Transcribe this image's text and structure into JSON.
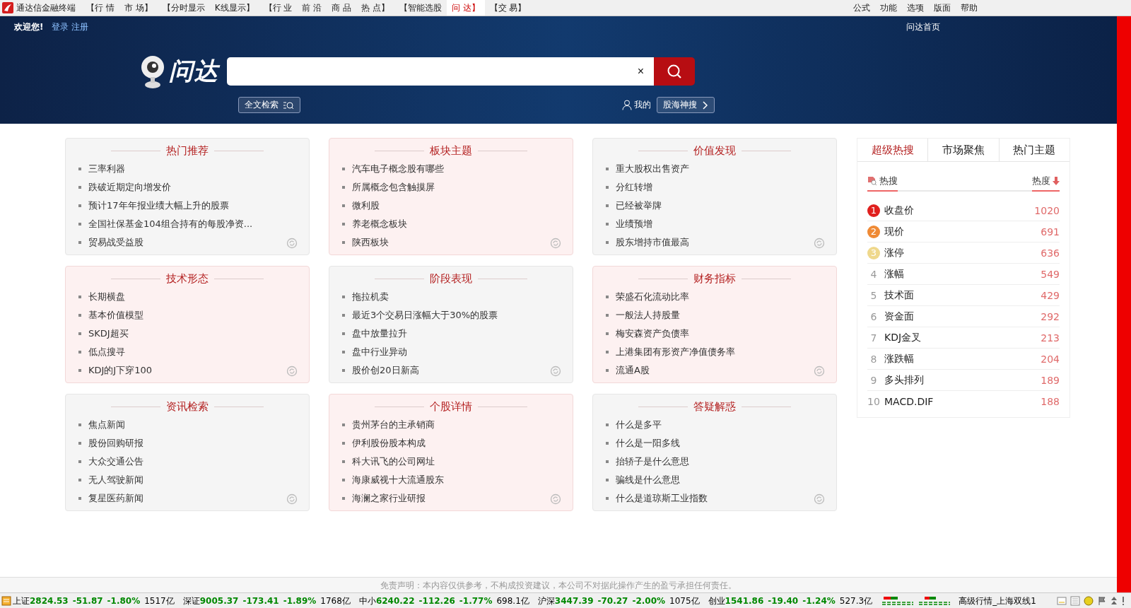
{
  "menu_bar": {
    "app_title": "通达信金融终端",
    "items": [
      {
        "label": "【行 情",
        "selected": false
      },
      {
        "label": "市 场】",
        "selected": false
      },
      {
        "label": "【分时显示",
        "selected": false
      },
      {
        "label": "K线显示】",
        "selected": false
      },
      {
        "label": "【行 业",
        "selected": false
      },
      {
        "label": "前 沿",
        "selected": false
      },
      {
        "label": "商 品",
        "selected": false
      },
      {
        "label": "热 点】",
        "selected": false
      },
      {
        "label": "【智能选股",
        "selected": false
      },
      {
        "label": "问 达】",
        "selected": true
      },
      {
        "label": "【交 易】",
        "selected": false
      }
    ],
    "right_items": [
      "公式",
      "功能",
      "选项",
      "版面",
      "帮助"
    ]
  },
  "header": {
    "welcome": "欢迎您!",
    "login": "登录",
    "register": "注册",
    "nav_links": [
      "问达首页"
    ],
    "logo_text": "问达",
    "search": {
      "clear": "×"
    },
    "fulltext_button": "全文检索",
    "mine": "我的",
    "deep_search_button": "股海神搜"
  },
  "cards": [
    {
      "title": "热门推荐",
      "kind": "plain",
      "items": [
        "三率利器",
        "跌破近期定向增发价",
        "预计17年年报业绩大幅上升的股票",
        "全国社保基金104组合持有的每股净资...",
        "贸易战受益股"
      ]
    },
    {
      "title": "板块主题",
      "kind": "tinted",
      "items": [
        "汽车电子概念股有哪些",
        "所属概念包含触摸屏",
        "微利股",
        "养老概念板块",
        "陕西板块"
      ]
    },
    {
      "title": "价值发现",
      "kind": "plain",
      "items": [
        "重大股权出售资产",
        "分红转增",
        "已经被举牌",
        "业绩预增",
        "股东增持市值最高"
      ]
    },
    {
      "title": "技术形态",
      "kind": "tinted",
      "items": [
        "长期横盘",
        "基本价值模型",
        "SKDJ超买",
        "低点搜寻",
        "KDJ的J下穿100"
      ]
    },
    {
      "title": "阶段表现",
      "kind": "plain",
      "items": [
        "拖拉机卖",
        "最近3个交易日涨幅大于30%的股票",
        "盘中放量拉升",
        "盘中行业异动",
        "股价创20日新高"
      ]
    },
    {
      "title": "财务指标",
      "kind": "tinted",
      "items": [
        "荣盛石化流动比率",
        "一般法人持股量",
        "梅安森资产负债率",
        "上港集团有形资产净值债务率",
        "流通A股"
      ]
    },
    {
      "title": "资讯检索",
      "kind": "plain",
      "items": [
        "焦点新闻",
        "股份回购研报",
        "大众交通公告",
        "无人驾驶新闻",
        "复星医药新闻"
      ]
    },
    {
      "title": "个股详情",
      "kind": "tinted",
      "items": [
        "贵州茅台的主承销商",
        "伊利股份股本构成",
        "科大讯飞的公司网址",
        "海康威视十大流通股东",
        "海澜之家行业研报"
      ]
    },
    {
      "title": "答疑解惑",
      "kind": "plain",
      "items": [
        "什么是多平",
        "什么是一阳多线",
        "抬轿子是什么意思",
        "骗线是什么意思",
        "什么是道琼斯工业指数"
      ]
    }
  ],
  "hot_panel": {
    "tabs": [
      {
        "label": "超级热搜",
        "selected": true
      },
      {
        "label": "市场聚焦",
        "selected": false
      },
      {
        "label": "热门主题",
        "selected": false
      }
    ],
    "col_name": "热搜",
    "col_heat": "热度",
    "rows": [
      {
        "rank": "1",
        "name": "收盘价",
        "heat": "1020",
        "color": "#e0201e"
      },
      {
        "rank": "2",
        "name": "现价",
        "heat": "691",
        "color": "#ef8a35"
      },
      {
        "rank": "3",
        "name": "涨停",
        "heat": "636",
        "color": "#efd88c"
      },
      {
        "rank": "4",
        "name": "涨幅",
        "heat": "549"
      },
      {
        "rank": "5",
        "name": "技术面",
        "heat": "429"
      },
      {
        "rank": "6",
        "name": "资金面",
        "heat": "292"
      },
      {
        "rank": "7",
        "name": "KDJ金叉",
        "heat": "213"
      },
      {
        "rank": "8",
        "name": "涨跌幅",
        "heat": "204"
      },
      {
        "rank": "9",
        "name": "多头排列",
        "heat": "189"
      },
      {
        "rank": "10",
        "name": "MACD.DIF",
        "heat": "188"
      }
    ]
  },
  "disclaimer": "免责声明：本内容仅供参考，不构成投资建议，本公司不对据此操作产生的盈亏承担任何责任。",
  "status_bar": {
    "indices": [
      {
        "name": "上证",
        "value": "2824.53",
        "change": "-51.87",
        "pct": "-1.80%",
        "volume": "1517亿"
      },
      {
        "name": "深证",
        "value": "9005.37",
        "change": "-173.41",
        "pct": "-1.89%",
        "volume": "1768亿"
      },
      {
        "name": "中小",
        "value": "6240.22",
        "change": "-112.26",
        "pct": "-1.77%",
        "volume": "698.1亿"
      },
      {
        "name": "沪深",
        "value": "3447.39",
        "change": "-70.27",
        "pct": "-2.00%",
        "volume": "1075亿"
      },
      {
        "name": "创业",
        "value": "1541.86",
        "change": "-19.40",
        "pct": "-1.24%",
        "volume": "527.3亿"
      }
    ],
    "connection": "高级行情_上海双线1"
  }
}
